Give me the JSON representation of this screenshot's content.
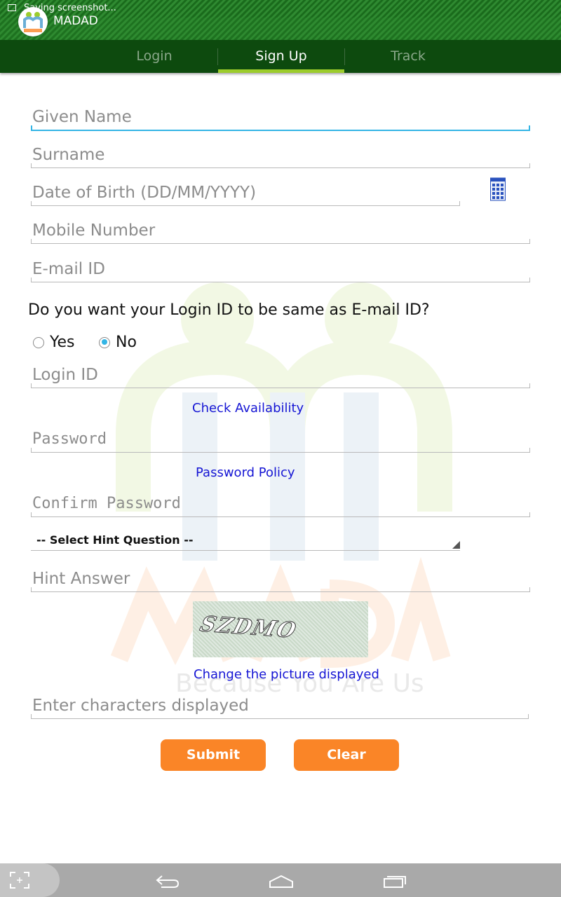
{
  "status_bar": {
    "notification": "Saving screenshot..."
  },
  "app_bar": {
    "title": "MADAD"
  },
  "tabs": [
    {
      "label": "Login",
      "active": false
    },
    {
      "label": "Sign Up",
      "active": true
    },
    {
      "label": "Track",
      "active": false
    }
  ],
  "form": {
    "given_name_placeholder": "Given Name",
    "surname_placeholder": "Surname",
    "dob_placeholder": "Date of Birth (DD/MM/YYYY)",
    "mobile_placeholder": "Mobile Number",
    "email_placeholder": "E-mail ID",
    "login_same_question": "Do you want your Login ID to be same as E-mail ID?",
    "radio_yes": "Yes",
    "radio_no": "No",
    "radio_selected": "No",
    "login_id_placeholder": "Login ID",
    "check_availability_link": "Check Availability",
    "password_placeholder": "Password",
    "password_policy_link": "Password Policy",
    "confirm_password_placeholder": "Confirm Password",
    "hint_question_selected": "-- Select Hint Question --",
    "hint_answer_placeholder": "Hint Answer",
    "captcha_text": "SZDMO",
    "change_picture_link": "Change the picture displayed",
    "captcha_input_placeholder": "Enter characters displayed",
    "submit_label": "Submit",
    "clear_label": "Clear"
  },
  "watermark": {
    "brand": "MADAD",
    "tagline": "Because You Are Us"
  },
  "colors": {
    "accent": "#33b5e5",
    "button": "#fa8527",
    "link": "#1515d4",
    "tab_indicator": "#9ccc2c",
    "header": "#0d4a0e"
  }
}
